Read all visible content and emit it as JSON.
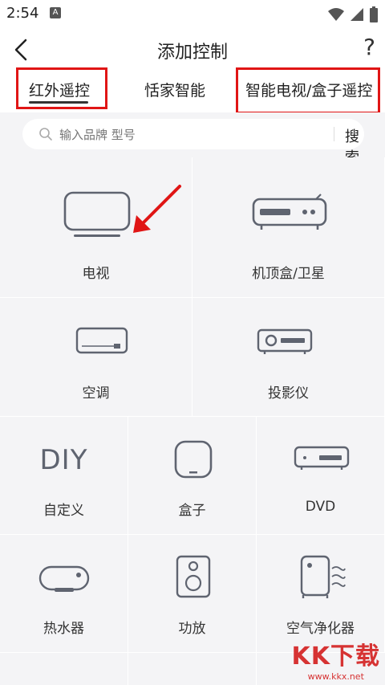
{
  "status_bar": {
    "time": "2:54",
    "notif_letter": "A"
  },
  "app_bar": {
    "title": "添加控制",
    "help_glyph": "?"
  },
  "tabs": [
    {
      "label": "红外遥控",
      "selected": true
    },
    {
      "label": "恬家智能",
      "selected": false
    },
    {
      "label": "智能电视/盒子遥控",
      "selected": false
    }
  ],
  "search": {
    "placeholder": "输入品牌 型号",
    "button_label": "搜索"
  },
  "devices": [
    {
      "label": "电视",
      "icon": "tv-icon"
    },
    {
      "label": "机顶盒/卫星",
      "icon": "set-top-box-icon"
    },
    {
      "label": "空调",
      "icon": "air-conditioner-icon"
    },
    {
      "label": "投影仪",
      "icon": "projector-icon"
    },
    {
      "label": "自定义",
      "icon": "diy-icon",
      "icon_text": "DIY"
    },
    {
      "label": "盒子",
      "icon": "box-icon"
    },
    {
      "label": "DVD",
      "icon": "dvd-icon"
    },
    {
      "label": "热水器",
      "icon": "water-heater-icon"
    },
    {
      "label": "功放",
      "icon": "amplifier-icon"
    },
    {
      "label": "空气净化器",
      "icon": "air-purifier-icon"
    }
  ],
  "watermark": {
    "main": "KK下载",
    "sub": "www.kkx.net"
  },
  "colors": {
    "highlight": "#e01515",
    "icon_stroke": "#5f6470",
    "grid_bg": "#f4f4f6"
  }
}
